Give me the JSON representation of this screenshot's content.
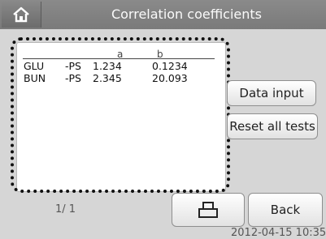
{
  "header": {
    "title": "Correlation coefficients",
    "home_icon": "home-icon"
  },
  "table": {
    "columns": [
      "a",
      "b"
    ],
    "rows": [
      {
        "name": "GLU",
        "suffix": "-PS",
        "a": "1.234",
        "b": "0.1234"
      },
      {
        "name": "BUN",
        "suffix": "-PS",
        "a": "2.345",
        "b": "20.093"
      }
    ]
  },
  "buttons": {
    "data_input": "Data input",
    "reset_all_tests": "Reset all tests",
    "print_icon": "printer-icon",
    "back": "Back"
  },
  "page_indicator": "1/ 1",
  "datetime": "2012-04-15 10:35",
  "colors": {
    "header_bg": "#7f7f7f",
    "screen_bg": "#d6d6d6"
  }
}
